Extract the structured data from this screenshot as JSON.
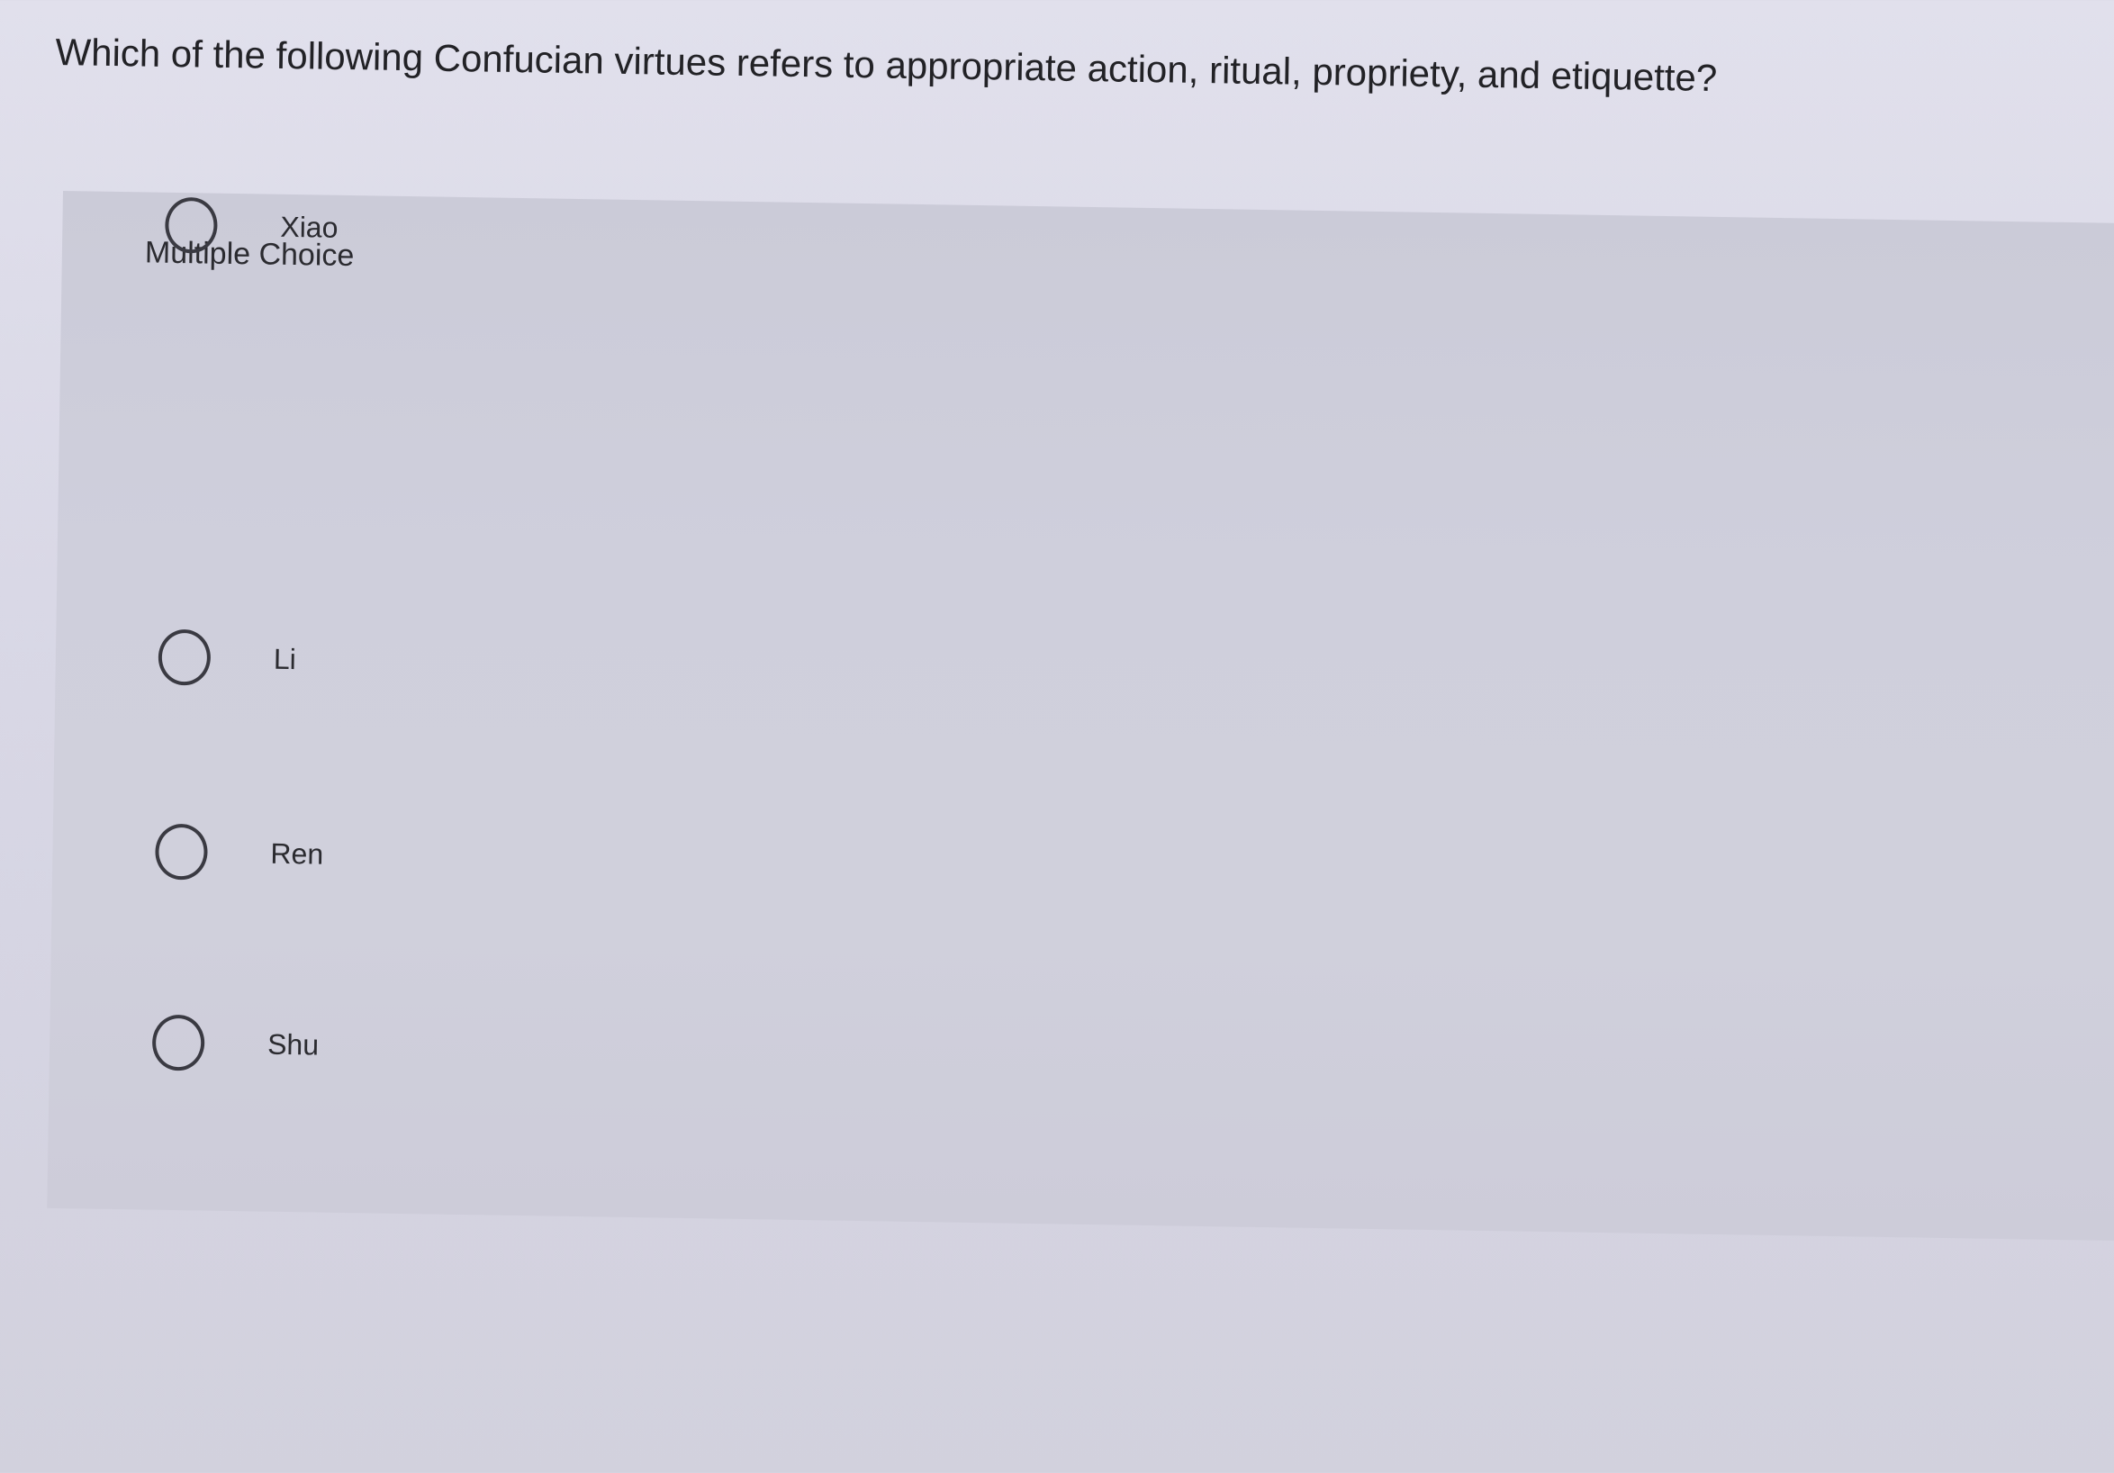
{
  "question": {
    "text": "Which of the following Confucian virtues refers to appropriate action, ritual, propriety, and etiquette?"
  },
  "choice_panel": {
    "label": "Multiple Choice",
    "options": [
      {
        "label": "Li",
        "selected": false
      },
      {
        "label": "Ren",
        "selected": false
      },
      {
        "label": "Shu",
        "selected": false
      },
      {
        "label": "Xiao",
        "selected": false
      }
    ]
  }
}
